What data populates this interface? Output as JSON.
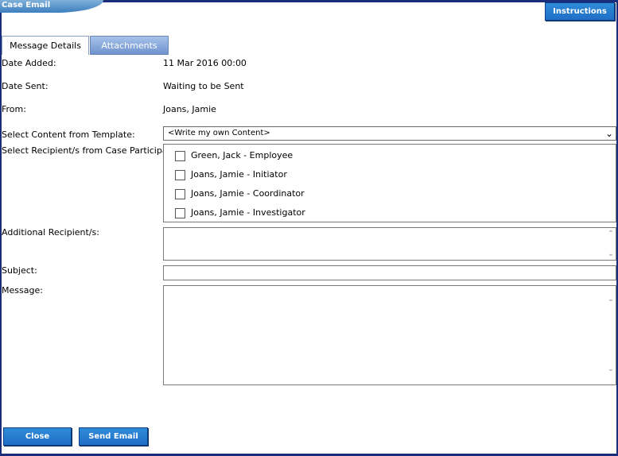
{
  "window": {
    "title": "Case Email"
  },
  "toolbar": {
    "instructions_label": "Instructions"
  },
  "tabs": [
    {
      "label": "Message Details",
      "active": true
    },
    {
      "label": "Attachments",
      "active": false
    }
  ],
  "fields": {
    "date_added": {
      "label": "Date Added:",
      "value": "11 Mar 2016 00:00"
    },
    "date_sent": {
      "label": "Date Sent:",
      "value": "Waiting to be Sent"
    },
    "from": {
      "label": "From:",
      "value": "Joans, Jamie"
    },
    "template": {
      "label": "Select Content from Template:",
      "value": "<Write my own Content>"
    },
    "recipients": {
      "label": "Select Recipient/s from Case Participants:",
      "items": [
        {
          "label": "Green, Jack - Employee",
          "checked": false
        },
        {
          "label": "Joans, Jamie - Initiator",
          "checked": false
        },
        {
          "label": "Joans, Jamie - Coordinator",
          "checked": false
        },
        {
          "label": "Joans, Jamie - Investigator",
          "checked": false
        }
      ]
    },
    "additional": {
      "label": "Additional Recipient/s:",
      "value": ""
    },
    "subject": {
      "label": "Subject:",
      "value": ""
    },
    "message": {
      "label": "Message:",
      "value": ""
    }
  },
  "footer": {
    "close_label": "Close",
    "send_label": "Send Email"
  },
  "colors": {
    "accent": "#1f6fc6",
    "frame": "#1a2d7a",
    "tab_inactive": "#6f93cf"
  }
}
